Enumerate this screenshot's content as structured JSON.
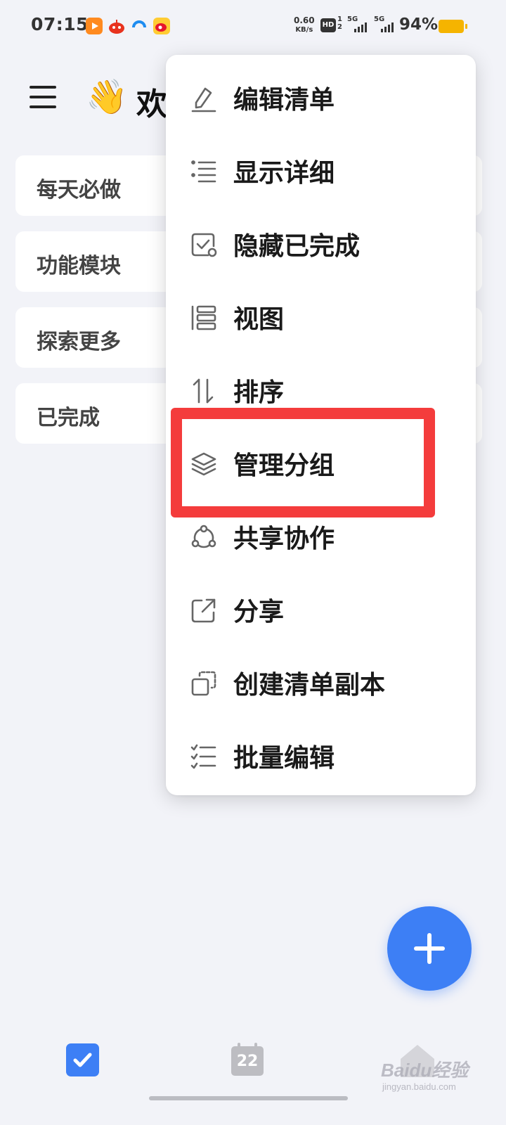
{
  "status_bar": {
    "time": "07:15",
    "net_speed_value": "0.60",
    "net_speed_unit": "KB/s",
    "hd_label": "HD",
    "hd_sub_top": "1",
    "hd_sub_bottom": "2",
    "signal1_label": "5G",
    "signal2_label": "5G",
    "battery_text": "94%",
    "battery_color": "#f5b400"
  },
  "header": {
    "menu_icon": "hamburger-icon",
    "emoji": "👋",
    "title": "欢"
  },
  "lists": [
    {
      "label": "每天必做"
    },
    {
      "label": "功能模块"
    },
    {
      "label": "探索更多"
    },
    {
      "label": "已完成"
    }
  ],
  "popup_menu": {
    "items": [
      {
        "label": "编辑清单",
        "icon": "pencil-icon"
      },
      {
        "label": "显示详细",
        "icon": "list-details-icon"
      },
      {
        "label": "隐藏已完成",
        "icon": "hide-completed-icon"
      },
      {
        "label": "视图",
        "icon": "view-layout-icon"
      },
      {
        "label": "排序",
        "icon": "sort-icon"
      },
      {
        "label": "管理分组",
        "icon": "layers-icon"
      },
      {
        "label": "共享协作",
        "icon": "share-collab-icon"
      },
      {
        "label": "分享",
        "icon": "share-external-icon"
      },
      {
        "label": "创建清单副本",
        "icon": "copy-icon"
      },
      {
        "label": "批量编辑",
        "icon": "batch-edit-icon"
      }
    ],
    "highlighted_item": "管理分组",
    "highlight_color": "#f43c3c"
  },
  "fab": {
    "icon": "plus-icon",
    "color": "#3d7ff5"
  },
  "bottom_nav": {
    "tasks_icon": "checkbox-icon",
    "calendar_day": "22",
    "calendar_icon": "calendar-icon",
    "more_icon": "home-icon"
  },
  "watermark": {
    "logo_text": "Baidu经验",
    "sub_text": "jingyan.baidu.com"
  }
}
